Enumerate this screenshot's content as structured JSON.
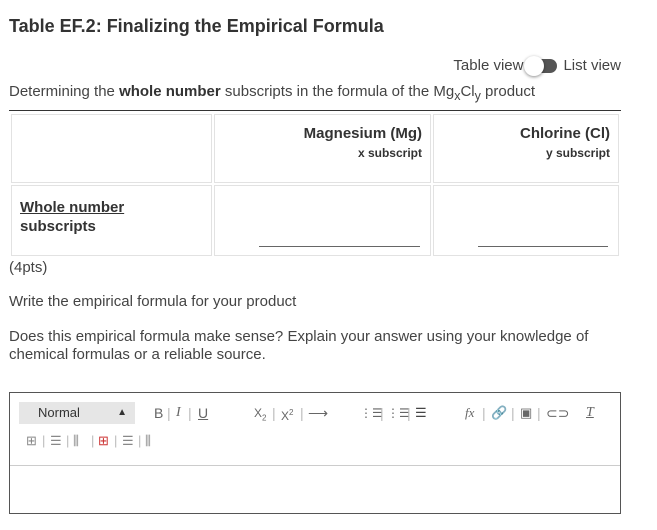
{
  "header": {
    "title": "Table EF.2: Finalizing the Empirical Formula"
  },
  "view_toggle": {
    "left_label": "Table view",
    "right_label": "List view"
  },
  "description": {
    "prefix": "Determining the ",
    "bold": "whole number",
    "middle": " subscripts in the formula of the Mg",
    "sub1": "x",
    "mid2": "Cl",
    "sub2": "y",
    "suffix": " product"
  },
  "table": {
    "columns": [
      {
        "title": "Magnesium (Mg)",
        "sub": "x subscript"
      },
      {
        "title": "Chlorine (Cl)",
        "sub": "y subscript"
      }
    ],
    "row_label_line1": "Whole number",
    "row_label_line2": "subscripts",
    "answers": [
      "",
      ""
    ]
  },
  "points": "(4pts)",
  "question1": "Write the empirical formula for your product",
  "question2": "Does this empirical formula make sense? Explain your answer using your knowledge of chemical formulas or a reliable source.",
  "editor": {
    "style_value": "Normal",
    "toolbar_icons": [
      "bold-icon",
      "italic-icon",
      "underline-icon",
      "subscript-icon",
      "superscript-icon",
      "indent-arrow-icon",
      "ordered-list-icon",
      "bullet-list-icon",
      "align-left-icon",
      "formula-icon",
      "link-icon",
      "image-icon",
      "attachment-icon",
      "clear-format-icon",
      "table-icon",
      "insert-row-above-icon",
      "insert-column-icon",
      "delete-table-icon",
      "delete-row-icon",
      "delete-column-icon"
    ],
    "content": ""
  }
}
